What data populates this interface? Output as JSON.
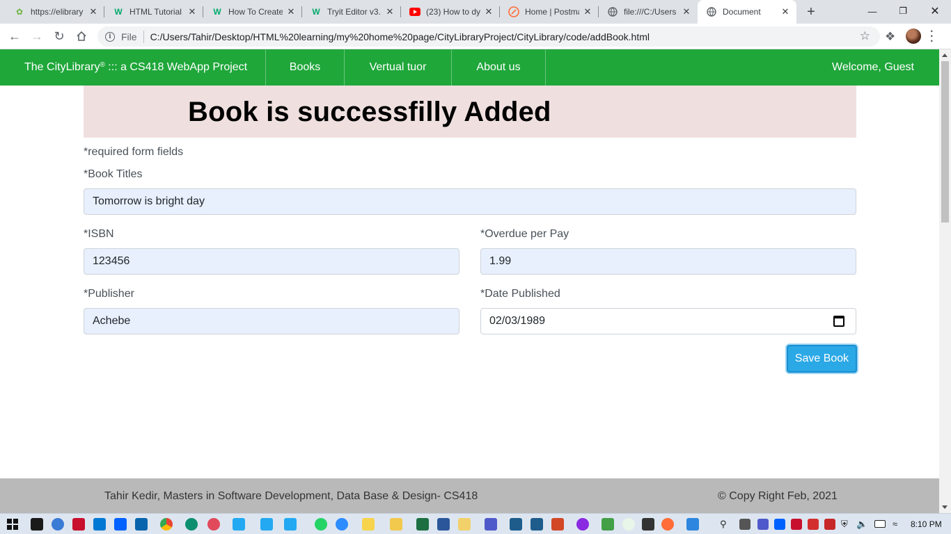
{
  "browser": {
    "tabs": [
      {
        "title": "https://elibrary",
        "icon": "spring-leaf-icon",
        "color": "#6db33f"
      },
      {
        "title": "HTML Tutorial",
        "icon": "w3schools-icon",
        "color": "#04aa6d"
      },
      {
        "title": "How To Create",
        "icon": "w3schools-icon",
        "color": "#04aa6d"
      },
      {
        "title": "Tryit Editor v3.",
        "icon": "w3schools-icon",
        "color": "#04aa6d"
      },
      {
        "title": "(23) How to dy",
        "icon": "youtube-icon",
        "color": "#ff0000"
      },
      {
        "title": "Home | Postma",
        "icon": "postman-icon",
        "color": "#ff6c37"
      },
      {
        "title": "file:///C:/Users",
        "icon": "globe-icon",
        "color": "#5f6368"
      },
      {
        "title": "Document",
        "icon": "globe-icon",
        "color": "#5f6368",
        "active": true
      }
    ],
    "address": {
      "scheme_label": "File",
      "url": "C:/Users/Tahir/Desktop/HTML%20learning/my%20home%20page/CityLibraryProject/CityLibrary/code/addBook.html"
    }
  },
  "site": {
    "brand": "The CityLibrary",
    "brand_mark": "®",
    "brand_suffix": " ::: a CS418 WebApp Project",
    "nav": [
      "Books",
      "Vertual tuor",
      "About us"
    ],
    "welcome": "Welcome, Guest",
    "nav_color": "#1fa73a"
  },
  "banner": {
    "message": "Book is successfilly Added",
    "color": "#efe0df"
  },
  "form": {
    "required_note": "*required form fields",
    "title_label": "*Book Titles",
    "title_value": "Tomorrow is bright day",
    "isbn_label": "*ISBN",
    "isbn_value": "123456",
    "overdue_label": "*Overdue per Pay",
    "overdue_value": "1.99",
    "publisher_label": "*Publisher",
    "publisher_value": "Achebe",
    "date_label": "*Date Published",
    "date_value": "02/03/1989",
    "save_label": "Save Book",
    "save_color": "#2ba8e6"
  },
  "footer": {
    "left": "Tahir Kedir, Masters in Software Development, Data Base & Design- CS418",
    "right": "© Copy Right Feb, 2021"
  },
  "taskbar": {
    "clock": "8:10 PM"
  }
}
